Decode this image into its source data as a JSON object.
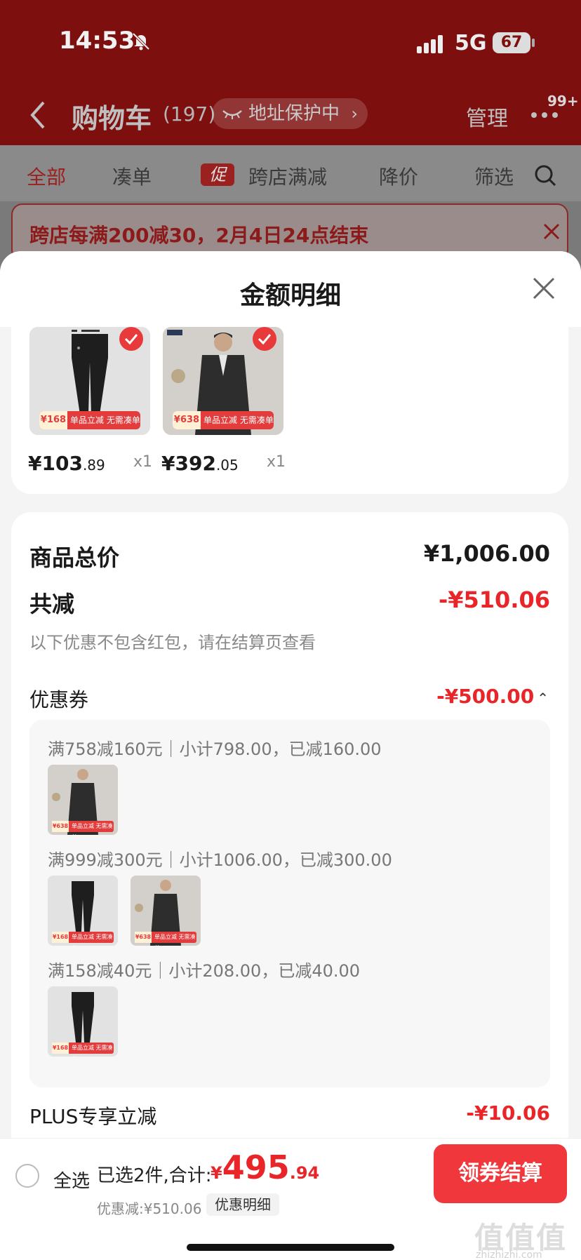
{
  "status_bar": {
    "time": "14:53",
    "network": "5G",
    "battery": "67"
  },
  "nav": {
    "title": "购物车",
    "count": "(197)",
    "address_protect": "地址保护中",
    "manage": "管理",
    "badge": "99+"
  },
  "tabs": [
    {
      "label": "全部",
      "active": true
    },
    {
      "label": "凑单"
    },
    {
      "label": "跨店满减",
      "tag": "促"
    },
    {
      "label": "降价"
    },
    {
      "label": "筛选"
    }
  ],
  "banner": {
    "text": "跨店每满200减30，2月4日24点结束"
  },
  "sheet": {
    "title": "金额明细"
  },
  "products": [
    {
      "price_int": "¥103",
      "price_dec": ".89",
      "qty": "x1",
      "tag_price": "¥168",
      "tag_text": "单品立减 无需凑单"
    },
    {
      "price_int": "¥392",
      "price_dec": ".05",
      "qty": "x1",
      "tag_price": "¥638",
      "tag_text": "单品立减 无需凑单"
    }
  ],
  "summary": {
    "total_label": "商品总价",
    "total_value": "¥1,006.00",
    "reduce_label": "共减",
    "reduce_value": "-¥510.06",
    "note": "以下优惠不包含红包，请在结算页查看",
    "coupon_label": "优惠券",
    "coupon_value": "-¥500.00",
    "coupon_rules": [
      {
        "text": "满758减160元｜小计798.00，已减160.00"
      },
      {
        "text": "满999减300元｜小计1006.00，已减300.00"
      },
      {
        "text": "满158减40元｜小计208.00，已减40.00"
      }
    ],
    "plus_label": "PLUS专享立减",
    "plus_value": "-¥10.06"
  },
  "bottom": {
    "select_all": "全选",
    "selected": "已选2件,合计:",
    "total_currency": "¥",
    "total_int": "495",
    "total_dec": ".94",
    "discount": "优惠减:¥510.06",
    "detail_button": "优惠明细",
    "checkout": "领券结算"
  },
  "watermark": {
    "main": "值值值",
    "sub": "zhizhizhi.com"
  },
  "colors": {
    "accent_red": "#e8262a",
    "header_bg": "#7e0f0f",
    "checkout_bg": "#f0383c"
  }
}
